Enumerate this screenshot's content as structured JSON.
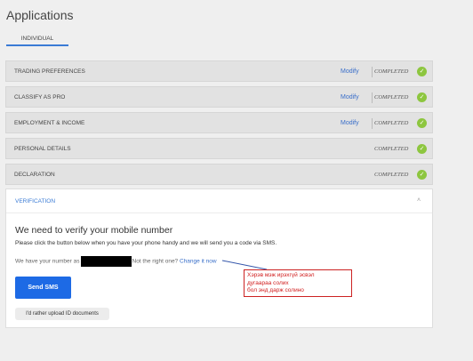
{
  "page": {
    "title": "Applications"
  },
  "tabs": [
    {
      "label": "INDIVIDUAL"
    }
  ],
  "sections": [
    {
      "label": "TRADING PREFERENCES",
      "modify": "Modify",
      "status": "COMPLETED"
    },
    {
      "label": "CLASSIFY AS PRO",
      "modify": "Modify",
      "status": "COMPLETED"
    },
    {
      "label": "EMPLOYMENT & INCOME",
      "modify": "Modify",
      "status": "COMPLETED"
    },
    {
      "label": "PERSONAL DETAILS",
      "modify": "",
      "status": "COMPLETED"
    },
    {
      "label": "DECLARATION",
      "modify": "",
      "status": "COMPLETED"
    }
  ],
  "verification": {
    "header": "VERIFICATION",
    "title": "We need to verify your mobile number",
    "instruction": "Please click the button below when you have your phone handy and we will send you a code via SMS.",
    "number_prefix": "We have your number as",
    "number_suffix": "Not the right one?",
    "change_link": "Change it now",
    "send_button": "Send SMS",
    "upload_button": "I'd rather upload ID documents"
  },
  "annotation": {
    "line1": "Хэрэв мэж ирэхгүй эсвэл",
    "line2": "дугаараа солих",
    "line3": "бол энд дарж солино"
  },
  "colors": {
    "accent": "#3a7bd5",
    "button": "#1d6ae5",
    "check": "#8dc63f",
    "annotation": "#d01c1c"
  }
}
